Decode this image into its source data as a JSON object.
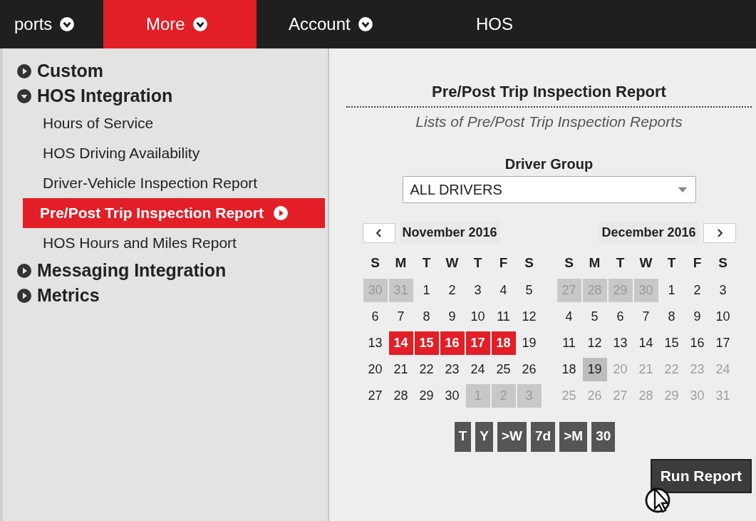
{
  "nav": [
    {
      "label": "ports",
      "selected": false,
      "caret": true
    },
    {
      "label": "More",
      "selected": true,
      "caret": true
    },
    {
      "label": "Account",
      "selected": false,
      "caret": true
    },
    {
      "label": "HOS",
      "selected": false,
      "caret": false
    }
  ],
  "menu": [
    {
      "label": "Custom",
      "expanded": false
    },
    {
      "label": "HOS Integration",
      "expanded": true,
      "children": [
        {
          "label": "Hours of Service",
          "selected": false
        },
        {
          "label": "HOS Driving Availability",
          "selected": false
        },
        {
          "label": "Driver-Vehicle Inspection Report",
          "selected": false
        },
        {
          "label": "Pre/Post Trip Inspection Report",
          "selected": true
        },
        {
          "label": "HOS Hours and Miles Report",
          "selected": false
        }
      ]
    },
    {
      "label": "Messaging Integration",
      "expanded": false
    },
    {
      "label": "Metrics",
      "expanded": false
    }
  ],
  "report": {
    "title": "Pre/Post Trip Inspection Report",
    "subtitle": "Lists of Pre/Post Trip Inspection Reports",
    "field_label": "Driver Group",
    "driver_group": "ALL DRIVERS"
  },
  "calendars": [
    {
      "month": "November 2016",
      "prev_button": true,
      "next_button": false,
      "weekdays": [
        "S",
        "M",
        "T",
        "W",
        "T",
        "F",
        "S"
      ],
      "weeks": [
        [
          {
            "d": "30",
            "kind": "other"
          },
          {
            "d": "31",
            "kind": "other"
          },
          {
            "d": "1",
            "kind": "normal"
          },
          {
            "d": "2",
            "kind": "normal"
          },
          {
            "d": "3",
            "kind": "normal"
          },
          {
            "d": "4",
            "kind": "normal"
          },
          {
            "d": "5",
            "kind": "normal"
          }
        ],
        [
          {
            "d": "6",
            "kind": "normal"
          },
          {
            "d": "7",
            "kind": "normal"
          },
          {
            "d": "8",
            "kind": "normal"
          },
          {
            "d": "9",
            "kind": "normal"
          },
          {
            "d": "10",
            "kind": "normal"
          },
          {
            "d": "11",
            "kind": "normal"
          },
          {
            "d": "12",
            "kind": "normal"
          }
        ],
        [
          {
            "d": "13",
            "kind": "normal"
          },
          {
            "d": "14",
            "kind": "selected"
          },
          {
            "d": "15",
            "kind": "selected"
          },
          {
            "d": "16",
            "kind": "selected"
          },
          {
            "d": "17",
            "kind": "selected"
          },
          {
            "d": "18",
            "kind": "selected"
          },
          {
            "d": "19",
            "kind": "normal"
          }
        ],
        [
          {
            "d": "20",
            "kind": "normal"
          },
          {
            "d": "21",
            "kind": "normal"
          },
          {
            "d": "22",
            "kind": "normal"
          },
          {
            "d": "23",
            "kind": "normal"
          },
          {
            "d": "24",
            "kind": "normal"
          },
          {
            "d": "25",
            "kind": "normal"
          },
          {
            "d": "26",
            "kind": "normal"
          }
        ],
        [
          {
            "d": "27",
            "kind": "normal"
          },
          {
            "d": "28",
            "kind": "normal"
          },
          {
            "d": "29",
            "kind": "normal"
          },
          {
            "d": "30",
            "kind": "normal"
          },
          {
            "d": "1",
            "kind": "other"
          },
          {
            "d": "2",
            "kind": "other"
          },
          {
            "d": "3",
            "kind": "other"
          }
        ]
      ]
    },
    {
      "month": "December 2016",
      "prev_button": false,
      "next_button": true,
      "weekdays": [
        "S",
        "M",
        "T",
        "W",
        "T",
        "F",
        "S"
      ],
      "weeks": [
        [
          {
            "d": "27",
            "kind": "other"
          },
          {
            "d": "28",
            "kind": "other"
          },
          {
            "d": "29",
            "kind": "other"
          },
          {
            "d": "30",
            "kind": "other"
          },
          {
            "d": "1",
            "kind": "normal"
          },
          {
            "d": "2",
            "kind": "normal"
          },
          {
            "d": "3",
            "kind": "normal"
          }
        ],
        [
          {
            "d": "4",
            "kind": "normal"
          },
          {
            "d": "5",
            "kind": "normal"
          },
          {
            "d": "6",
            "kind": "normal"
          },
          {
            "d": "7",
            "kind": "normal"
          },
          {
            "d": "8",
            "kind": "normal"
          },
          {
            "d": "9",
            "kind": "normal"
          },
          {
            "d": "10",
            "kind": "normal"
          }
        ],
        [
          {
            "d": "11",
            "kind": "normal"
          },
          {
            "d": "12",
            "kind": "normal"
          },
          {
            "d": "13",
            "kind": "normal"
          },
          {
            "d": "14",
            "kind": "normal"
          },
          {
            "d": "15",
            "kind": "normal"
          },
          {
            "d": "16",
            "kind": "normal"
          },
          {
            "d": "17",
            "kind": "normal"
          }
        ],
        [
          {
            "d": "18",
            "kind": "normal"
          },
          {
            "d": "19",
            "kind": "today"
          },
          {
            "d": "20",
            "kind": "disabled"
          },
          {
            "d": "21",
            "kind": "disabled"
          },
          {
            "d": "22",
            "kind": "disabled"
          },
          {
            "d": "23",
            "kind": "disabled"
          },
          {
            "d": "24",
            "kind": "disabled"
          }
        ],
        [
          {
            "d": "25",
            "kind": "disabled"
          },
          {
            "d": "26",
            "kind": "disabled"
          },
          {
            "d": "27",
            "kind": "disabled"
          },
          {
            "d": "28",
            "kind": "disabled"
          },
          {
            "d": "29",
            "kind": "disabled"
          },
          {
            "d": "30",
            "kind": "disabled"
          },
          {
            "d": "31",
            "kind": "disabled"
          }
        ]
      ]
    }
  ],
  "quick_ranges": [
    "T",
    "Y",
    ">W",
    "7d",
    ">M",
    "30"
  ],
  "run_button": "Run Report"
}
